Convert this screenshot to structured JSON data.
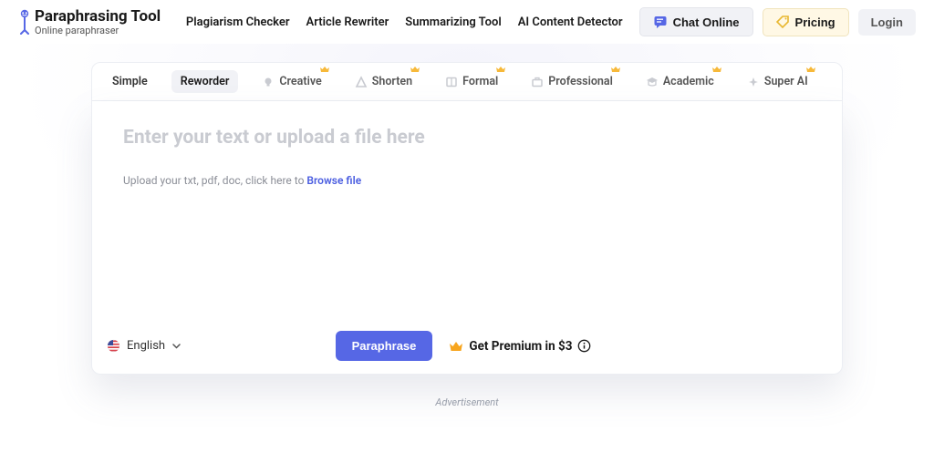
{
  "brand": {
    "title": "Paraphrasing Tool",
    "subtitle": "Online paraphraser"
  },
  "nav": {
    "links": [
      "Plagiarism Checker",
      "Article Rewriter",
      "Summarizing Tool",
      "AI Content Detector"
    ],
    "chat": "Chat Online",
    "pricing": "Pricing",
    "login": "Login"
  },
  "tabs": {
    "simple": "Simple",
    "reworder": "Reworder",
    "creative": "Creative",
    "shorten": "Shorten",
    "formal": "Formal",
    "professional": "Professional",
    "academic": "Academic",
    "superai": "Super AI"
  },
  "editor": {
    "placeholder": "Enter your text or upload a file here",
    "uploadPrefix": "Upload your txt, pdf, doc, click here to ",
    "browse": "Browse file"
  },
  "footer": {
    "language": "English",
    "paraphrase": "Paraphrase",
    "premium": "Get Premium in $3"
  },
  "ad": "Advertisement"
}
